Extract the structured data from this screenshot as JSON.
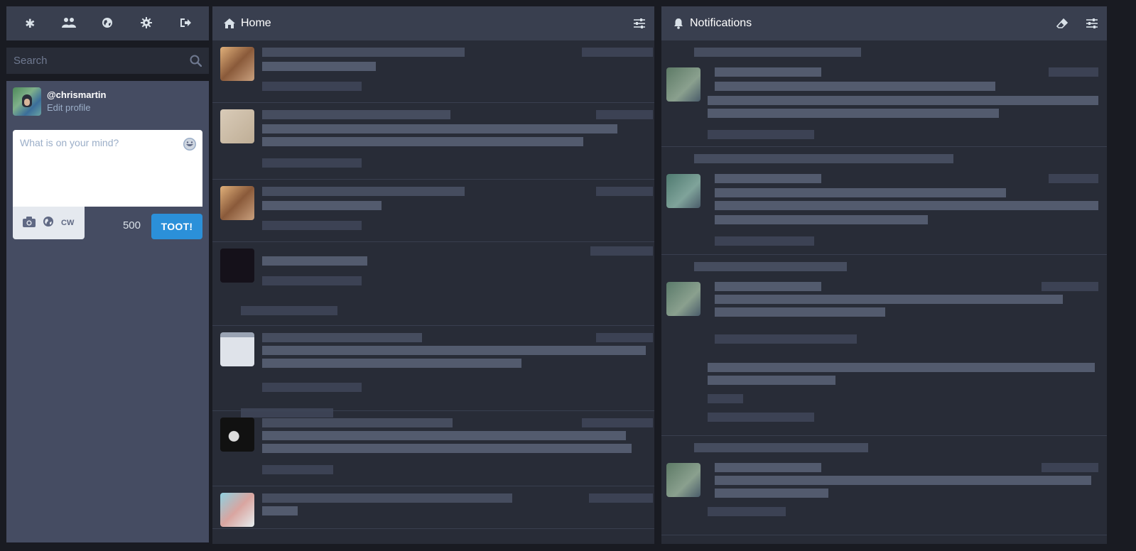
{
  "nav": {
    "items": [
      {
        "icon": "asterisk-icon",
        "glyph": "✱"
      },
      {
        "icon": "users-icon",
        "glyph": "👥"
      },
      {
        "icon": "globe-icon",
        "glyph": "🌐"
      },
      {
        "icon": "gear-icon",
        "glyph": "⚙"
      },
      {
        "icon": "sign-out-icon",
        "glyph": "⇥"
      }
    ]
  },
  "search": {
    "placeholder": "Search"
  },
  "account": {
    "handle": "@chrismartin",
    "edit_label": "Edit profile"
  },
  "compose": {
    "placeholder": "What is on your mind?",
    "cw_label": "CW",
    "char_count": "500",
    "submit_label": "TOOT!"
  },
  "columns": {
    "home": {
      "title": "Home"
    },
    "notifications": {
      "title": "Notifications"
    }
  },
  "colors": {
    "background": "#191b22",
    "column": "#282c37",
    "header": "#393f4f",
    "compose_panel": "#454c62",
    "accent": "#2b90d9"
  }
}
